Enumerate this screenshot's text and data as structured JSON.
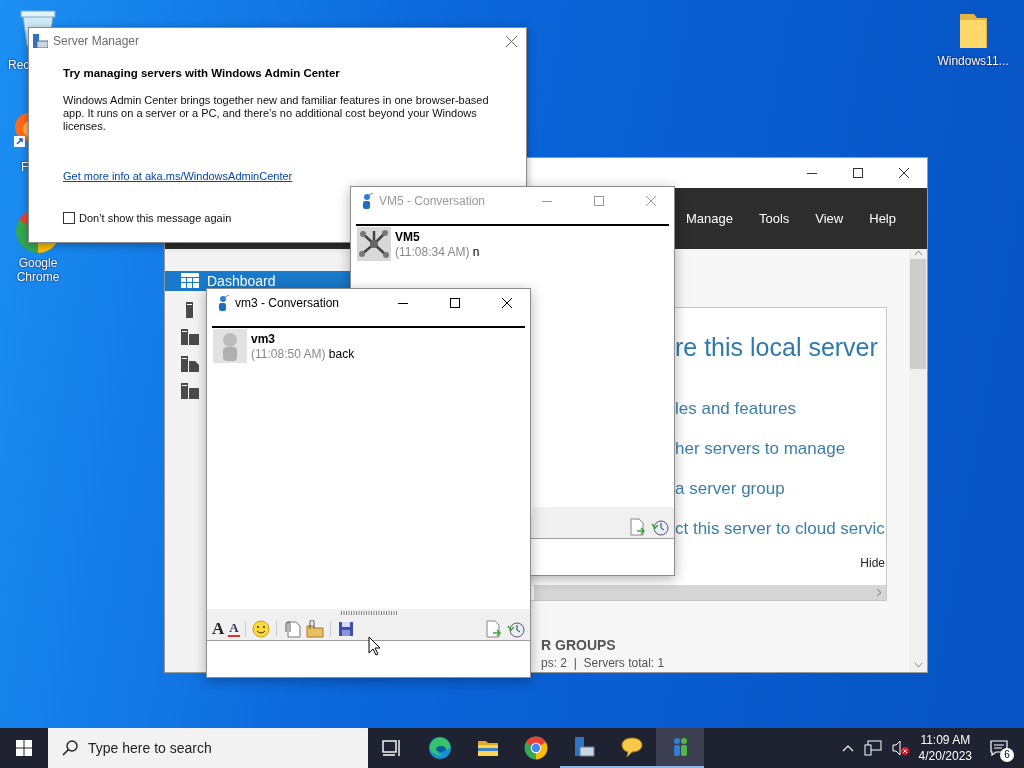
{
  "desktop_icons": [
    {
      "kind": "bin",
      "label": "Rec"
    },
    {
      "kind": "firefox",
      "label": "F"
    },
    {
      "kind": "chrome",
      "label": "Google Chrome"
    },
    {
      "kind": "folder",
      "label": "Windows11..."
    }
  ],
  "server_manager": {
    "menu": [
      "Manage",
      "Tools",
      "View",
      "Help"
    ],
    "nav": [
      {
        "kind": "dashboard",
        "label": "Dashboard",
        "selected": true
      },
      {
        "kind": "server",
        "selected": false
      },
      {
        "kind": "servers",
        "selected": false
      },
      {
        "kind": "files",
        "selected": false
      },
      {
        "kind": "servers",
        "selected": false
      }
    ],
    "welcome": {
      "title": "re this local server",
      "links": [
        "les and features",
        "her servers to manage",
        "a server group",
        "ct this server to cloud servic"
      ],
      "hide": "Hide"
    },
    "groups": {
      "heading": "R GROUPS",
      "summary": "ps: 2  |  Servers total: 1"
    }
  },
  "dialog": {
    "title": "Server Manager",
    "heading": "Try managing servers with Windows Admin Center",
    "body": "Windows Admin Center brings together new and familiar features in one browser-based app. It runs on a server or a PC, and there’s no additional cost beyond your Windows licenses.",
    "link": "Get more info at aka.ms/WindowsAdminCenter",
    "checkbox": {
      "label": "Don’t show this message again",
      "checked": false
    }
  },
  "conversations": [
    {
      "title": "VM5 - Conversation",
      "active": false,
      "messages": [
        {
          "kind": "hub",
          "sender": "VM5",
          "time": "(11:08:34 AM)",
          "text": "n"
        }
      ],
      "tools_right": [
        {
          "kind": "send-file"
        },
        {
          "kind": "history"
        }
      ]
    },
    {
      "title": "vm3 - Conversation",
      "active": true,
      "messages": [
        {
          "kind": "figure",
          "sender": "vm3",
          "time": "(11:08:50 AM)",
          "text": "back"
        }
      ],
      "tools_left": [
        {
          "kind": "font",
          "text": "A"
        },
        {
          "kind": "font-color",
          "text": "A"
        },
        {
          "kind": "smiley"
        },
        {
          "kind": "attach-file"
        },
        {
          "kind": "attach-folder"
        },
        {
          "kind": "save"
        }
      ],
      "tools_right": [
        {
          "kind": "send-file"
        },
        {
          "kind": "history"
        }
      ]
    }
  ],
  "taskbar": {
    "search_placeholder": "Type here to search",
    "apps": [
      {
        "kind": "task-view",
        "open": false,
        "selected": false
      },
      {
        "kind": "edge",
        "open": false,
        "selected": false
      },
      {
        "kind": "explorer",
        "open": false,
        "selected": false
      },
      {
        "kind": "chrome",
        "open": false,
        "selected": false
      },
      {
        "kind": "server-manager",
        "open": true,
        "selected": false
      },
      {
        "kind": "chat",
        "open": true,
        "selected": false
      },
      {
        "kind": "messenger",
        "open": true,
        "selected": true
      }
    ],
    "time": "11:09 AM",
    "date": "4/20/2023",
    "notifications": "6"
  }
}
